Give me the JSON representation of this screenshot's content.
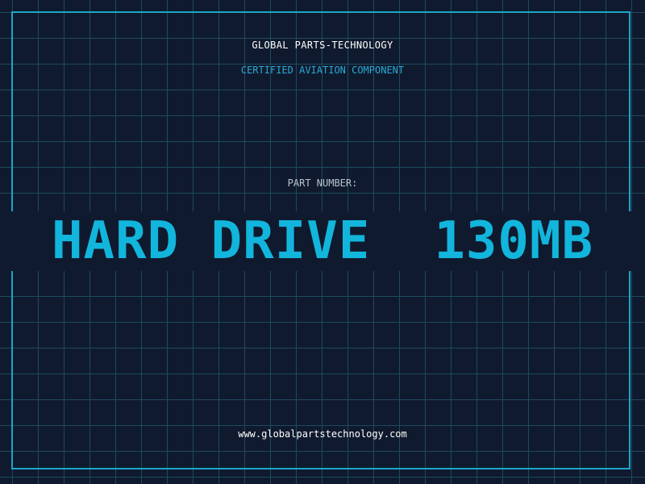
{
  "header": {
    "company": "GLOBAL PARTS-TECHNOLOGY",
    "subtitle": "CERTIFIED AVIATION COMPONENT"
  },
  "part": {
    "label": "PART NUMBER:",
    "value": "HARD DRIVE  130MB"
  },
  "footer": {
    "website": "www.globalpartstechnology.com"
  },
  "colors": {
    "background": "#101a2e",
    "grid": "#1d4a5e",
    "border": "#1aa6c9",
    "accent": "#12b5dc",
    "subtitle": "#29a9d6",
    "label": "#b8c3cf",
    "text": "#ffffff"
  }
}
